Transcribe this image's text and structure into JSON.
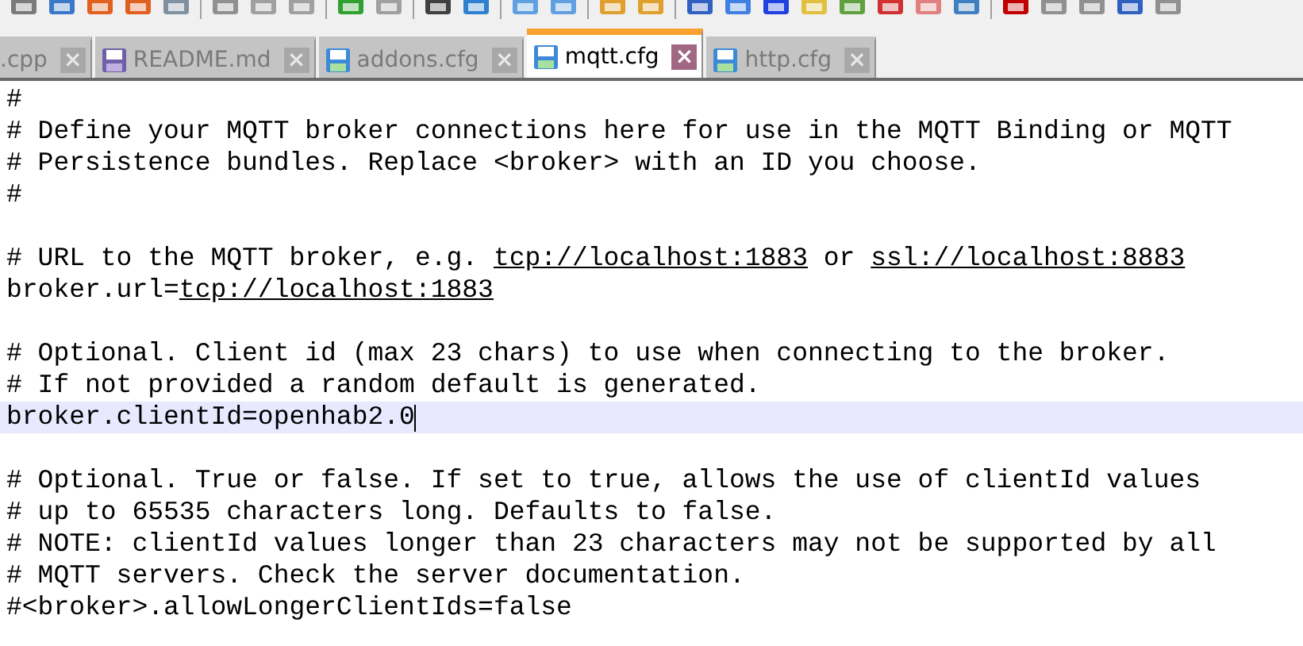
{
  "tabs": [
    {
      "label": ".cpp",
      "selected": false
    },
    {
      "label": "README.md",
      "selected": false
    },
    {
      "label": "addons.cfg",
      "selected": false
    },
    {
      "label": "mqtt.cfg",
      "selected": true
    },
    {
      "label": "http.cfg",
      "selected": false
    }
  ],
  "close_glyph": "×",
  "lines": [
    {
      "current": false,
      "segments": [
        {
          "text": "#",
          "link": false
        }
      ]
    },
    {
      "current": false,
      "segments": [
        {
          "text": "# Define your MQTT broker connections here for use in the MQTT Binding or MQTT",
          "link": false
        }
      ]
    },
    {
      "current": false,
      "segments": [
        {
          "text": "# Persistence bundles. Replace <broker> with an ID you choose.",
          "link": false
        }
      ]
    },
    {
      "current": false,
      "segments": [
        {
          "text": "#",
          "link": false
        }
      ]
    },
    {
      "current": false
    },
    {
      "current": false,
      "segments": [
        {
          "text": "# URL to the MQTT broker, e.g. ",
          "link": false
        },
        {
          "text": "tcp://localhost:1883",
          "link": true
        },
        {
          "text": " or ",
          "link": false
        },
        {
          "text": "ssl://localhost:8883",
          "link": true
        }
      ]
    },
    {
      "current": false,
      "segments": [
        {
          "text": "broker.url=",
          "link": false
        },
        {
          "text": "tcp://localhost:1883",
          "link": true
        }
      ]
    },
    {
      "current": false
    },
    {
      "current": false,
      "segments": [
        {
          "text": "# Optional. Client id (max 23 chars) to use when connecting to the broker.",
          "link": false
        }
      ]
    },
    {
      "current": false,
      "segments": [
        {
          "text": "# If not provided a random default is generated.",
          "link": false
        }
      ]
    },
    {
      "current": true,
      "segments": [
        {
          "text": "broker.clientId=openhab2.0",
          "link": false
        }
      ]
    },
    {
      "current": false
    },
    {
      "current": false,
      "segments": [
        {
          "text": "# Optional. True or false. If set to true, allows the use of clientId values",
          "link": false
        }
      ]
    },
    {
      "current": false,
      "segments": [
        {
          "text": "# up to 65535 characters long. Defaults to false.",
          "link": false
        }
      ]
    },
    {
      "current": false,
      "segments": [
        {
          "text": "# NOTE: clientId values longer than 23 characters may not be supported by all",
          "link": false
        }
      ]
    },
    {
      "current": false,
      "segments": [
        {
          "text": "# MQTT servers. Check the server documentation.",
          "link": false
        }
      ]
    },
    {
      "current": false,
      "segments": [
        {
          "text": "#<broker>.allowLongerClientIds=false",
          "link": false
        }
      ]
    }
  ]
}
